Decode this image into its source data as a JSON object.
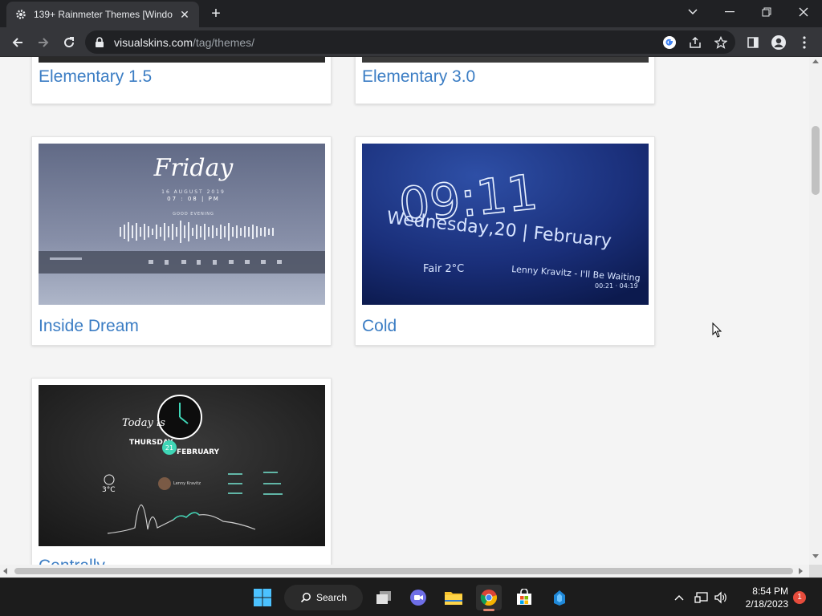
{
  "browser": {
    "tab_title": "139+ Rainmeter Themes [Windo",
    "url_host": "visualskins.com",
    "url_path": "/tag/themes/"
  },
  "cards": [
    {
      "name": "Elementary 1.5"
    },
    {
      "name": "Elementary 3.0"
    },
    {
      "name": "Inside Dream"
    },
    {
      "name": "Cold"
    },
    {
      "name": "Centrally"
    }
  ],
  "thumbs": {
    "inside_dream": {
      "day": "Friday",
      "date": "16 AUGUST 2019",
      "time": "07 : 08 | PM",
      "greeting": "GOOD EVENING"
    },
    "cold": {
      "time": "09:11",
      "date": "Wednesday,20 | February",
      "weather": "Fair 2°C",
      "song": "Lenny Kravitz - I'll Be Waiting",
      "progress": "00:21 · 04:19"
    },
    "centrally": {
      "today": "Today is",
      "weekday": "THURSDAY",
      "day": "21",
      "month": "FEBRUARY",
      "temp": "3°C",
      "artist": "Lenny Kravitz"
    }
  },
  "taskbar": {
    "search_label": "Search",
    "time": "8:54 PM",
    "date": "2/18/2023",
    "notifications": "1"
  }
}
